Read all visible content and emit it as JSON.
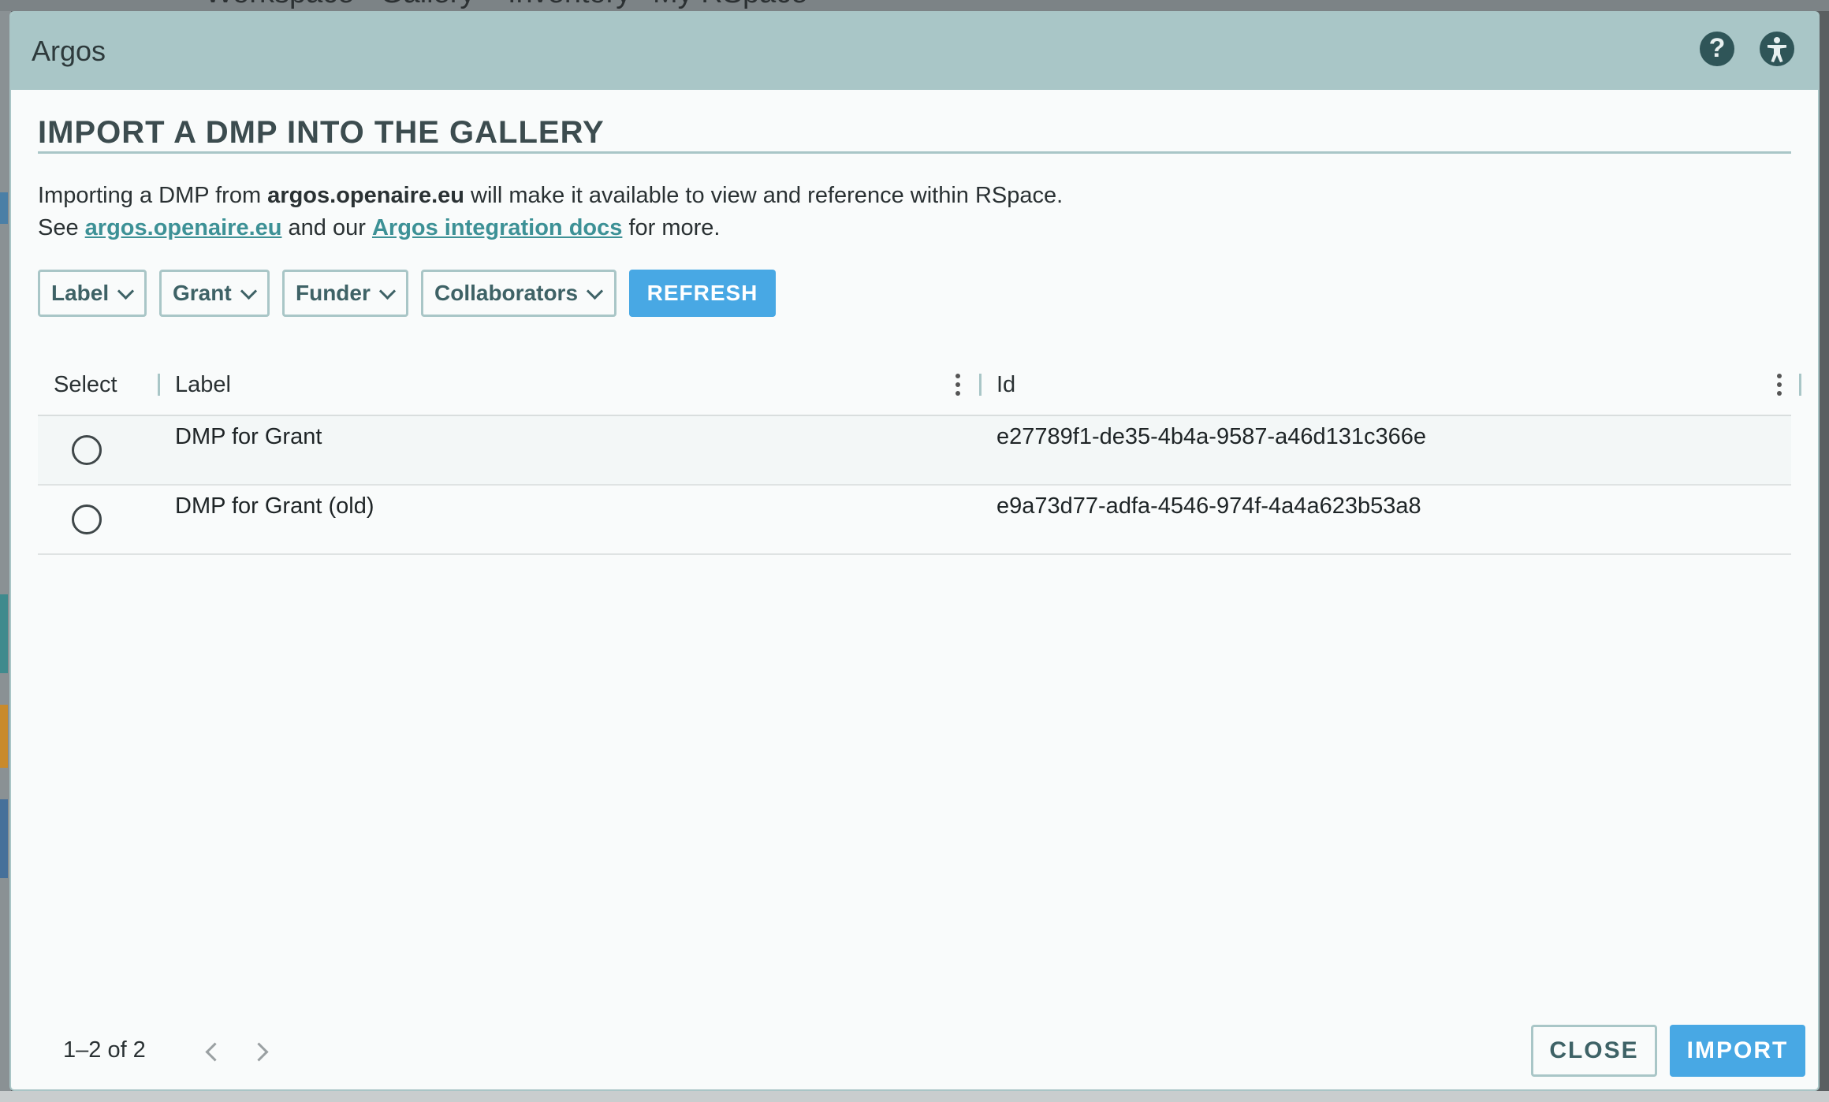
{
  "background_app": {
    "nav_items": [
      "Workspace",
      "Gallery",
      "Inventory",
      "My RSpace"
    ]
  },
  "dialog": {
    "title": "Argos",
    "header_icons": [
      "help-icon",
      "accessibility-icon"
    ],
    "section_title": "IMPORT A DMP INTO THE GALLERY",
    "intro": {
      "line1_prefix": "Importing a DMP from ",
      "line1_bold": "argos.openaire.eu",
      "line1_suffix": " will make it available to view and reference within RSpace.",
      "line2_prefix": "See ",
      "link1": "argos.openaire.eu",
      "line2_mid": " and our ",
      "link2": "Argos integration docs",
      "line2_suffix": " for more."
    },
    "filters": {
      "label": "Label",
      "grant": "Grant",
      "funder": "Funder",
      "collaborators": "Collaborators",
      "refresh": "REFRESH"
    },
    "table": {
      "columns": {
        "select": "Select",
        "label": "Label",
        "id": "Id"
      },
      "rows": [
        {
          "label": "DMP for Grant",
          "id": "e27789f1-de35-4b4a-9587-a46d131c366e"
        },
        {
          "label": "DMP for Grant (old)",
          "id": "e9a73d77-adfa-4546-974f-4a4a623b53a8"
        }
      ]
    },
    "pagination": {
      "text": "1–2 of 2"
    },
    "footer": {
      "close": "CLOSE",
      "import": "IMPORT"
    },
    "colors": {
      "header_bg": "#a9c6c7",
      "accent_blue": "#48a8e4",
      "link_teal": "#3d9196"
    }
  }
}
